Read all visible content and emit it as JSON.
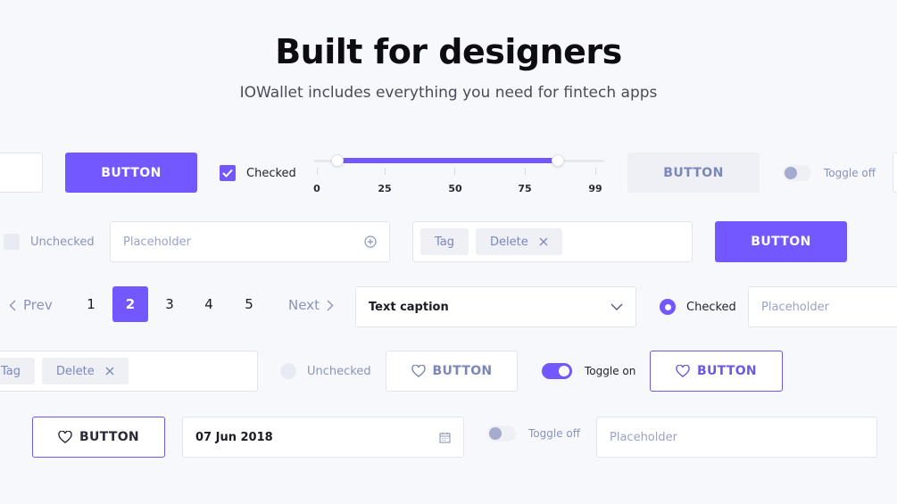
{
  "header": {
    "title": "Built for designers",
    "subtitle": "IOWallet includes everything you need for fintech apps"
  },
  "row1": {
    "primary_button": "BUTTON",
    "checkbox_label": "Checked",
    "slider": {
      "ticks": [
        "0",
        "25",
        "50",
        "75",
        "99"
      ],
      "range_low": 0,
      "range_high": 99
    },
    "grey_button": "BUTTON",
    "toggle_label": "Toggle off"
  },
  "row2": {
    "unchecked_label": "Unchecked",
    "input_placeholder": "Placeholder",
    "tag_label": "Tag",
    "delete_tag_label": "Delete",
    "primary_button": "BUTTON"
  },
  "row3": {
    "prev_label": "Prev",
    "pages": [
      "1",
      "2",
      "3",
      "4",
      "5"
    ],
    "active_page": "2",
    "next_label": "Next",
    "select_value": "Text caption",
    "radio_label": "Checked",
    "input_placeholder": "Placeholder"
  },
  "row4": {
    "tag_label": "Tag",
    "delete_tag_label": "Delete",
    "radio_label": "Unchecked",
    "light_button": "BUTTON",
    "toggle_label": "Toggle on",
    "outline_button": "BUTTON"
  },
  "row5": {
    "outline_button": "BUTTON",
    "date_value": "07 Jun 2018",
    "toggle_label": "Toggle off",
    "input_placeholder": "Placeholder"
  },
  "colors": {
    "accent": "#7357ff",
    "background": "#f7f8fb",
    "muted": "#8a93bd"
  }
}
